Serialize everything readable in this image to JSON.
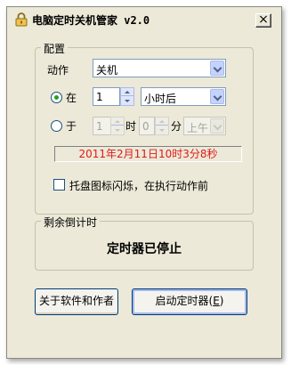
{
  "window": {
    "title": "电脑定时关机管家 v2.0",
    "close_glyph": "×"
  },
  "config": {
    "group_label": "配置",
    "action_label": "动作",
    "action_value": "关机",
    "after_label": "在",
    "after_value": "1",
    "after_unit": "小时后",
    "at_label": "于",
    "at_hour": "1",
    "hour_label": "时",
    "at_minute": "0",
    "minute_label": "分",
    "ampm": "上午",
    "target_time": "2011年2月11日10时3分8秒",
    "tray_checkbox_label": "托盘图标闪烁，在执行动作前",
    "tray_checked": false,
    "mode_selected": "after"
  },
  "countdown": {
    "group_label": "剩余倒计时",
    "status": "定时器已停止"
  },
  "buttons": {
    "about": "关于软件和作者",
    "start": "启动定时器",
    "start_shortcut_prefix": "(",
    "start_shortcut_key": "E",
    "start_shortcut_suffix": ")"
  },
  "icons": {
    "app": "padlock-icon",
    "close": "close-icon",
    "dropdown": "chevron-down-icon"
  },
  "colors": {
    "window_bg": "#ece9d8",
    "target_time_text": "#e11a1a",
    "radio_dot": "#21a121",
    "input_border": "#7f9db9"
  }
}
